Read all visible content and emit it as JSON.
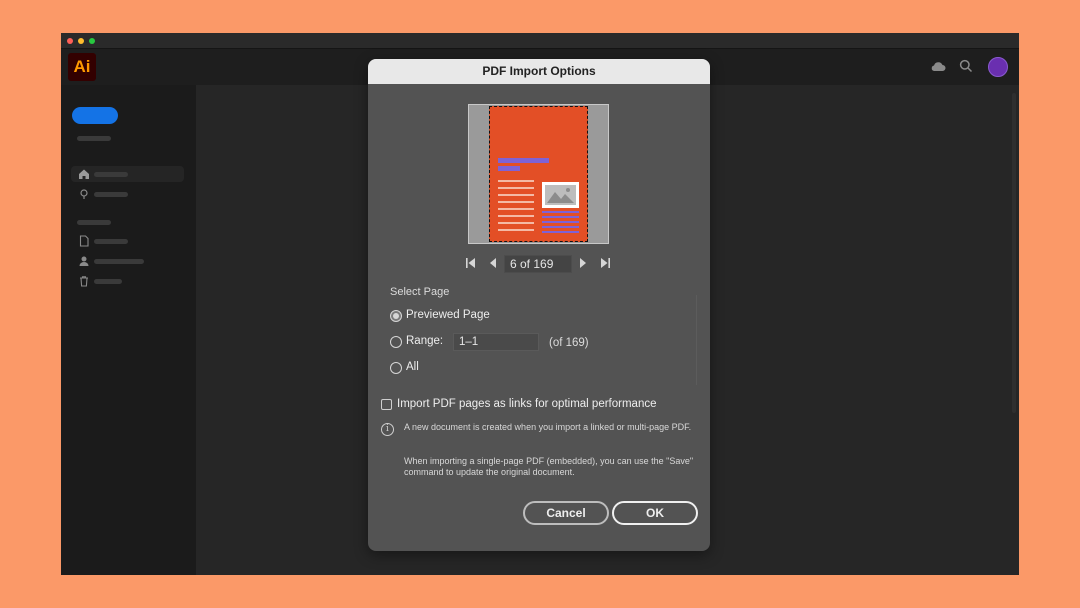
{
  "app": {
    "logo_text": "Ai",
    "colors": {
      "logo_bg": "#330000",
      "logo_fg": "#ff9a00",
      "accent": "#1473e6",
      "backdrop": "#fb9968"
    },
    "appbar_icons": [
      "cloud-icon",
      "search-icon",
      "avatar"
    ]
  },
  "dialog": {
    "title": "PDF Import Options",
    "navigation": {
      "page_field": "6 of 169",
      "buttons": [
        "first-page-icon",
        "previous-page-icon",
        "next-page-icon",
        "last-page-icon"
      ]
    },
    "select_page": {
      "label": "Select Page",
      "options": {
        "previewed": "Previewed Page",
        "range": "Range:",
        "all": "All"
      },
      "selected": "previewed",
      "range_value": "1–1",
      "range_of": "(of 169)"
    },
    "links_checkbox": {
      "label": "Import PDF pages as links for optimal performance",
      "checked": false
    },
    "info": {
      "line1": "A new document is created when you import a linked or multi-page PDF.",
      "line2": "When importing a single-page PDF (embedded), you can use the \"Save\" command to update the original document."
    },
    "buttons": {
      "cancel": "Cancel",
      "ok": "OK"
    }
  }
}
